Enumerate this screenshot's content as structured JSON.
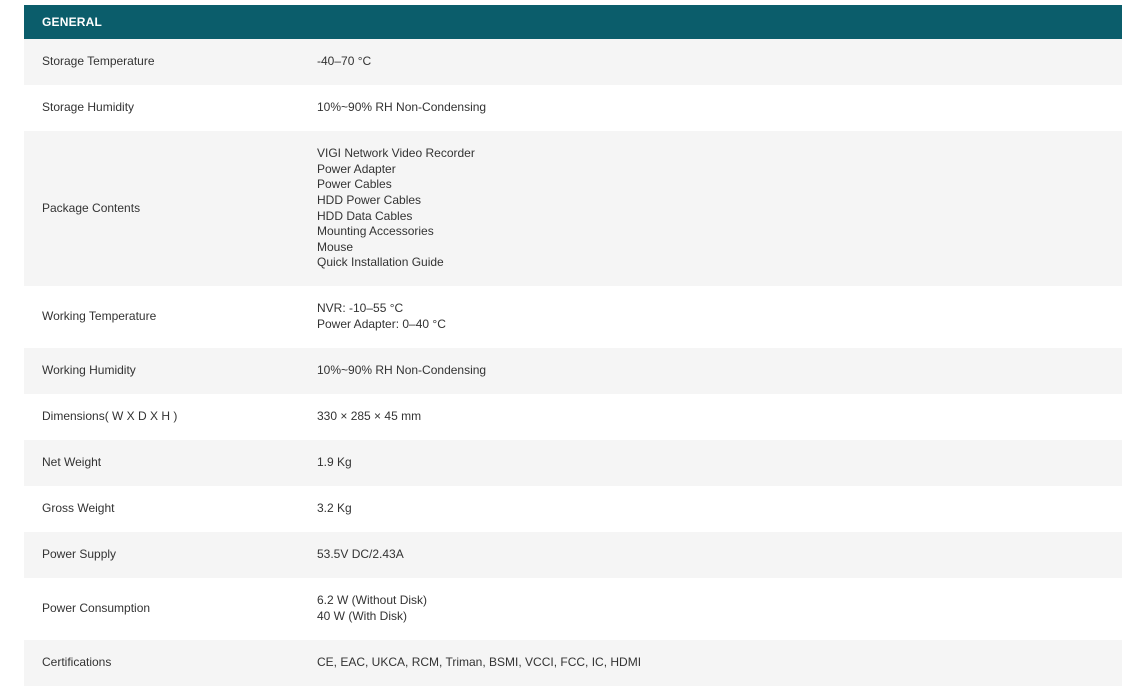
{
  "section": {
    "title": "GENERAL"
  },
  "rows": [
    {
      "label": "Storage Temperature",
      "values": [
        "-40–70 °C"
      ]
    },
    {
      "label": "Storage Humidity",
      "values": [
        "10%~90% RH Non-Condensing"
      ]
    },
    {
      "label": "Package Contents",
      "values": [
        "VIGI Network Video Recorder",
        "Power Adapter",
        "Power Cables",
        "HDD Power Cables",
        "HDD Data Cables",
        "Mounting Accessories",
        "Mouse",
        "Quick Installation Guide"
      ]
    },
    {
      "label": "Working Temperature",
      "values": [
        "NVR: -10–55 °C",
        "Power Adapter: 0–40 °C"
      ]
    },
    {
      "label": "Working Humidity",
      "values": [
        "10%~90% RH Non-Condensing"
      ]
    },
    {
      "label": "Dimensions( W X D X H )",
      "values": [
        "330 × 285 × 45 mm"
      ]
    },
    {
      "label": "Net Weight",
      "values": [
        "1.9 Kg"
      ]
    },
    {
      "label": "Gross Weight",
      "values": [
        "3.2 Kg"
      ]
    },
    {
      "label": "Power Supply",
      "values": [
        "53.5V DC/2.43A"
      ]
    },
    {
      "label": "Power Consumption",
      "values": [
        "6.2 W (Without Disk)",
        "40 W (With Disk)"
      ]
    },
    {
      "label": "Certifications",
      "values": [
        "CE, EAC, UKCA, RCM, Triman, BSMI, VCCI, FCC, IC, HDMI"
      ]
    }
  ]
}
